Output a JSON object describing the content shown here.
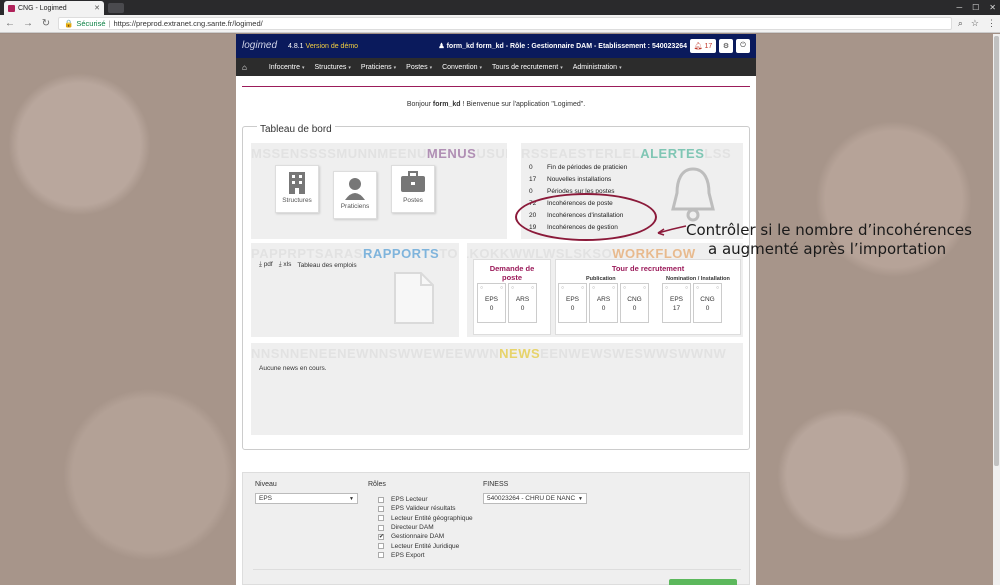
{
  "browser": {
    "tab_title": "CNG - Logimed",
    "secure_label": "Sécurisé",
    "url": "https://preprod.extranet.cng.sante.fr/logimed/"
  },
  "app": {
    "logo": "logimed",
    "version": "4.8.1",
    "demo_label": "Version de démo",
    "user_info": "form_kd form_kd - Rôle : Gestionnaire DAM - Etablissement : 540023264",
    "alert_count": "17",
    "menu": [
      "Infocentre",
      "Structures",
      "Praticiens",
      "Postes",
      "Convention",
      "Tours de recrutement",
      "Administration"
    ],
    "welcome": {
      "prefix": "Bonjour",
      "user": "form_kd",
      "suffix": "! Bienvenue sur l'application \"Logimed\"."
    }
  },
  "dashboard": {
    "title": "Tableau de bord",
    "menus": {
      "watermark_pre": "MSSENSSSSMUNNMEENU",
      "label": "MENUS",
      "watermark_post": "USUI",
      "tiles": [
        "Structures",
        "Praticiens",
        "Postes"
      ]
    },
    "alertes": {
      "watermark_pre": "RSSEAESTERLEL",
      "label": "ALERTES",
      "watermark_post": "LSS",
      "items": [
        {
          "count": "0",
          "label": "Fin de périodes de praticien"
        },
        {
          "count": "17",
          "label": "Nouvelles installations"
        },
        {
          "count": "0",
          "label": "Périodes sur les postes"
        },
        {
          "count": "72",
          "label": "Incohérences de poste"
        },
        {
          "count": "20",
          "label": "Incohérences d'installation"
        },
        {
          "count": "19",
          "label": "Incohérences de gestion"
        }
      ]
    },
    "rapports": {
      "watermark_pre": "PAPPRPTSARAS",
      "label": "RAPPORTS",
      "watermark_post": "TO",
      "pdf_label": "pdf",
      "xls_label": "xls",
      "report_name": "Tableau des emplois"
    },
    "workflow": {
      "watermark_pre": "LKOKKWWLWSLSKSO",
      "label": "WORKFLOW",
      "watermark_post": "",
      "demande_title": "Demande de poste",
      "tour_title": "Tour de recrutement",
      "publication_label": "Publication",
      "nomination_label": "Nomination / Installation",
      "demande": [
        {
          "label": "EPS",
          "value": "0"
        },
        {
          "label": "ARS",
          "value": "0"
        }
      ],
      "publication": [
        {
          "label": "EPS",
          "value": "0"
        },
        {
          "label": "ARS",
          "value": "0"
        },
        {
          "label": "CNG",
          "value": "0"
        }
      ],
      "nomination": [
        {
          "label": "EPS",
          "value": "17"
        },
        {
          "label": "CNG",
          "value": "0"
        }
      ]
    },
    "news": {
      "watermark_pre": "NNSNNENEENEWNNSWWEWEEWWN",
      "label": "NEWS",
      "watermark_post": "EENWEWSWESWWSWWNW",
      "empty_text": "Aucune news en cours."
    }
  },
  "annotation": {
    "line1": "Contrôler si le nombre d’incohérences",
    "line2": "a augmenté après l’importation"
  },
  "filters": {
    "niveau_label": "Niveau",
    "niveau_value": "EPS",
    "roles_label": "Rôles",
    "roles": [
      {
        "label": "EPS Lecteur",
        "checked": false
      },
      {
        "label": "EPS Valideur résultats",
        "checked": false
      },
      {
        "label": "Lecteur Entité géographique",
        "checked": false
      },
      {
        "label": "Directeur DAM",
        "checked": false
      },
      {
        "label": "Gestionnaire DAM",
        "checked": true
      },
      {
        "label": "Lecteur Entité Juridique",
        "checked": false
      },
      {
        "label": "EPS Export",
        "checked": false
      }
    ],
    "finess_label": "FINESS",
    "finess_value": "540023264 - CHRU DE NANC"
  },
  "colors": {
    "header": "#0a1a5c",
    "accent": "#9b1b5a",
    "annotation": "#8b1a3a"
  }
}
